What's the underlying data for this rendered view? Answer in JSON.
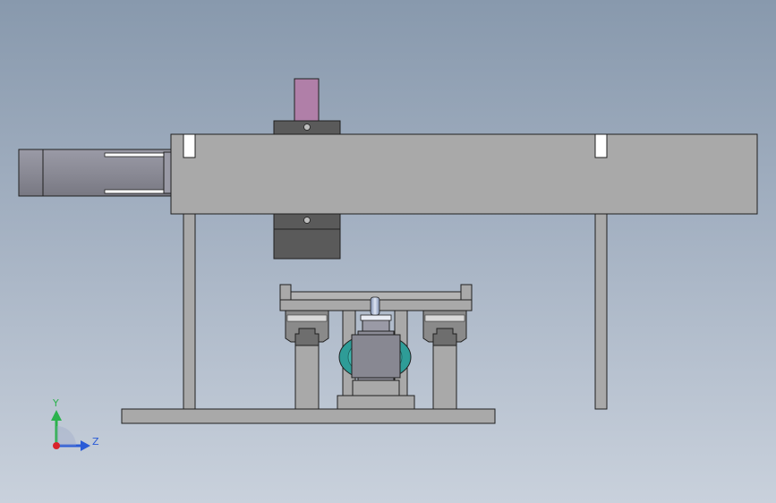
{
  "viewport": {
    "background_top": "#8899ad",
    "background_bottom": "#c9d1dc",
    "part_fill": "#a9a9a9",
    "part_edge": "#202020",
    "dark_block": "#555555",
    "pink_block": "#b07fa8",
    "motor_fill": "#8c8c96",
    "teal_part": "#2e9c97"
  },
  "triad": {
    "y_label": "Y",
    "z_label": "Z",
    "y_color": "#2bb24c",
    "z_color": "#2a5bd7",
    "x_color": "#d9232a"
  }
}
